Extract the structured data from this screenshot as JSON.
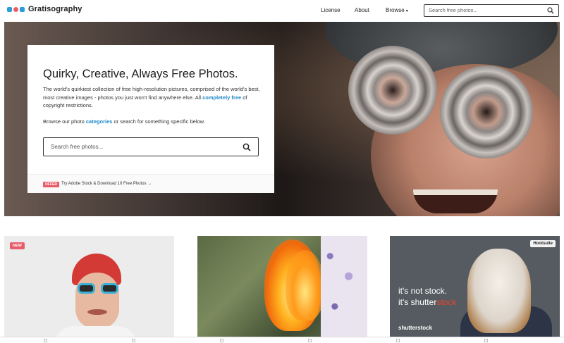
{
  "header": {
    "logo_text": "Gratisography",
    "logo_colors": [
      "#2d9cdb",
      "#e85d6a",
      "#2d9cdb"
    ],
    "nav": {
      "license": "License",
      "about": "About",
      "browse": "Browse"
    },
    "search_placeholder": "Search free photos..."
  },
  "hero": {
    "title": "Quirky, Creative, Always Free Photos.",
    "desc_part1": "The world's quirkiest collection of free high-resolution pictures, comprised of the world's best, most creative images - photos you just won't find anywhere else. All",
    "desc_link": "completely free",
    "desc_part2": "of copyright restrictions.",
    "browse_part1": "Browse our photo",
    "browse_link": "categories",
    "browse_part2": "or search for something specific below.",
    "search_placeholder": "Search free photos...",
    "offer_badge": "OFFER",
    "offer_text": "Try Adobe Stock & Download 10 Free Photos →"
  },
  "cards": {
    "new_badge": "NEW",
    "ad": {
      "line1": "it's not stock.",
      "line2_a": "it's shutter",
      "line2_b": "stock",
      "brand": "shutterstock",
      "hootsuite": "Hootsuite"
    }
  },
  "colors": {
    "accent": "#1e88c7",
    "badge": "#e85d6a"
  }
}
